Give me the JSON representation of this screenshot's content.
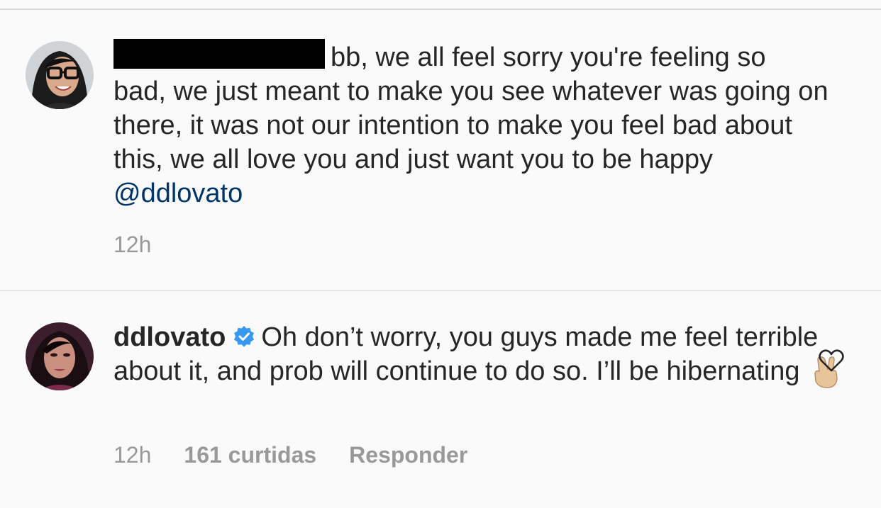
{
  "comments": [
    {
      "username_redacted": true,
      "text_line1": "bb, we all feel sorry you're feeling so",
      "text_rest": "bad, we just meant to make you see whatever was going on there, it was not our intention to make you feel bad about this, we all love you and just want you to be happy ",
      "mention": "@ddlovato",
      "time": "12h"
    },
    {
      "username": "ddlovato",
      "verified": true,
      "text": "Oh don’t worry, you guys made me feel terrible about it, and prob will continue to do so. I’ll be hibernating",
      "emoji": "victory-hand-emoji",
      "time": "12h",
      "likes": "161 curtidas",
      "reply_label": "Responder"
    }
  ],
  "colors": {
    "text": "#262626",
    "meta": "#999999",
    "mention": "#003569",
    "verified": "#3897f0",
    "background": "#fafafa"
  }
}
